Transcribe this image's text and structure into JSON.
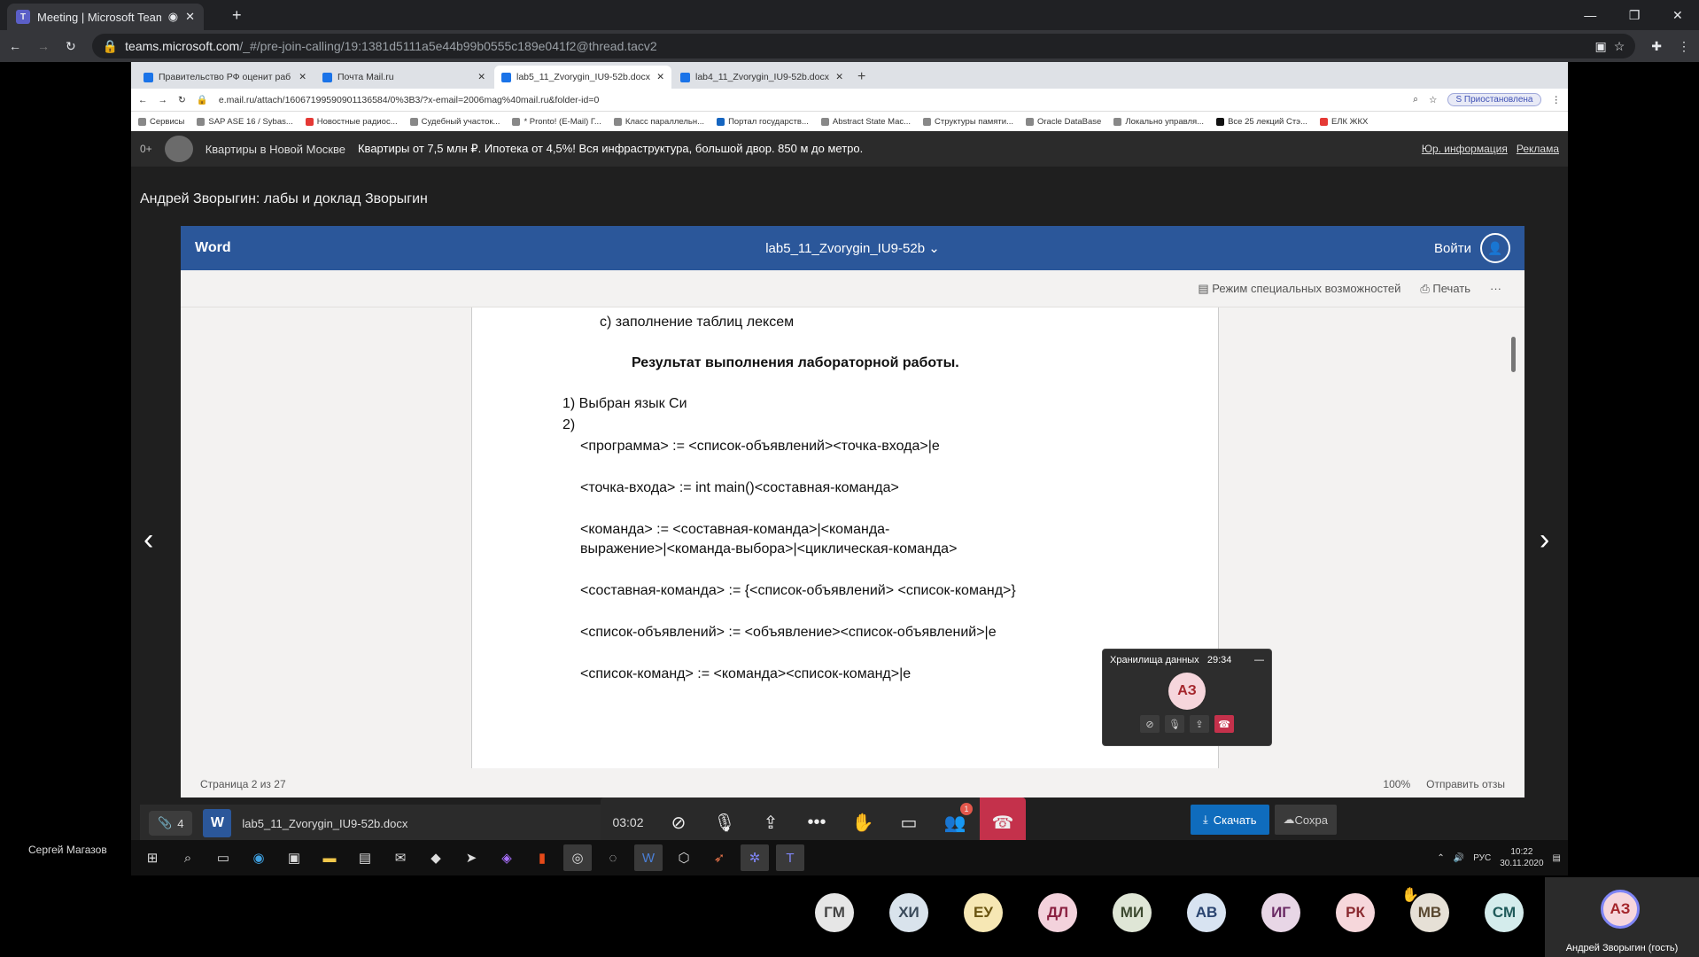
{
  "outer_browser": {
    "tab_title": "Meeting | Microsoft Teams",
    "url": "teams.microsoft.com",
    "url_rest": "/_#/pre-join-calling/19:1381d5111a5e44b99b0555c189e041f2@thread.tacv2"
  },
  "inner_browser": {
    "tabs": [
      {
        "label": "Правительство РФ оценит раб"
      },
      {
        "label": "Почта Mail.ru"
      },
      {
        "label": "lab5_11_Zvorygin_IU9-52b.docx"
      },
      {
        "label": "lab4_11_Zvorygin_IU9-52b.docx"
      }
    ],
    "url": "e.mail.ru/attach/16067199590901136584/0%3B3/?x-email=2006mag%40mail.ru&folder-id=0",
    "paused_label": "Приостановлена",
    "profile_letter": "S",
    "bookmarks": [
      "Сервисы",
      "SAP ASE 16 / Sybas...",
      "Новостные радиос...",
      "Судебный участок...",
      "* Pronto! (E-Mail) Г...",
      "Класс параллельн...",
      "Портал государств...",
      "Abstract State Mac...",
      "Структуры памяти...",
      "Oracle DataBase",
      "Локально управля...",
      "Все 25 лекций Стэ...",
      "ЕЛК ЖКХ"
    ]
  },
  "ad": {
    "age": "0+",
    "title": "Квартиры в Новой Москве",
    "text": "Квартиры от 7,5 млн ₽. Ипотека от 4,5%! Вся инфраструктура, большой двор. 850 м до метро.",
    "link1": "Юр. информация",
    "link2": "Реклама"
  },
  "doc_title": "Андрей Зворыгин: лабы и доклад Зворыгин",
  "word": {
    "brand": "Word",
    "filename": "lab5_11_Zvorygin_IU9-52b",
    "signin": "Войти",
    "accessibility": "Режим специальных возможностей",
    "print": "Печать",
    "more": "···",
    "status_page": "Страница 2 из 27",
    "zoom": "100%",
    "feedback": "Отправить отзы"
  },
  "document": {
    "line_c": "c)  заполнение таблиц лексем",
    "heading": "Результат выполнения лабораторной работы.",
    "item1": "1)  Выбран язык Си",
    "item2": "2)",
    "rule1": "<программа> := <список-объявлений><точка-входа>|e",
    "rule2": "<точка-входа> := int main()<составная-команда>",
    "rule3a": "<команда> := <составная-команда>|<команда-",
    "rule3b": "выражение>|<команда-выбора>|<циклическая-команда>",
    "rule4": "<составная-команда> := {<список-объявлений> <список-команд>}",
    "rule5": "<список-объявлений> := <объявление><список-объявлений>|e",
    "rule6": "<список-команд> := <команда><список-команд>|e"
  },
  "meeting": {
    "attach_count": "4",
    "file_icon_letter": "W",
    "file_name": "lab5_11_Zvorygin_IU9-52b.docx",
    "timer": "03:02",
    "participants_badge": "1",
    "download": "Скачать",
    "save": "Сохра",
    "mini_title": "Хранилища данных",
    "mini_time": "29:34",
    "mini_initials": "АЗ",
    "presenter": "Сергей Магазов",
    "self_initials": "АЗ",
    "self_name": "Андрей Зворыгин (гость)",
    "participants": [
      {
        "initials": "ГМ",
        "bg": "#e6e6e6",
        "fg": "#444"
      },
      {
        "initials": "ХИ",
        "bg": "#d9e3ec",
        "fg": "#3a4a5a"
      },
      {
        "initials": "ЕУ",
        "bg": "#f6e7b4",
        "fg": "#6a5410"
      },
      {
        "initials": "ДЛ",
        "bg": "#f3d2dc",
        "fg": "#8a2040"
      },
      {
        "initials": "МИ",
        "bg": "#dfe6d6",
        "fg": "#3d4a30"
      },
      {
        "initials": "АВ",
        "bg": "#d8e3f1",
        "fg": "#2a4470"
      },
      {
        "initials": "ИГ",
        "bg": "#e8d6e6",
        "fg": "#6a2a64"
      },
      {
        "initials": "РК",
        "bg": "#f6d7db",
        "fg": "#8a2a30"
      },
      {
        "initials": "МВ",
        "bg": "#e6e0d6",
        "fg": "#5a4830"
      },
      {
        "initials": "СМ",
        "bg": "#d4ecec",
        "fg": "#1f5a5a"
      }
    ]
  },
  "taskbar": {
    "lang": "РУС",
    "time": "10:22",
    "date": "30.11.2020"
  }
}
